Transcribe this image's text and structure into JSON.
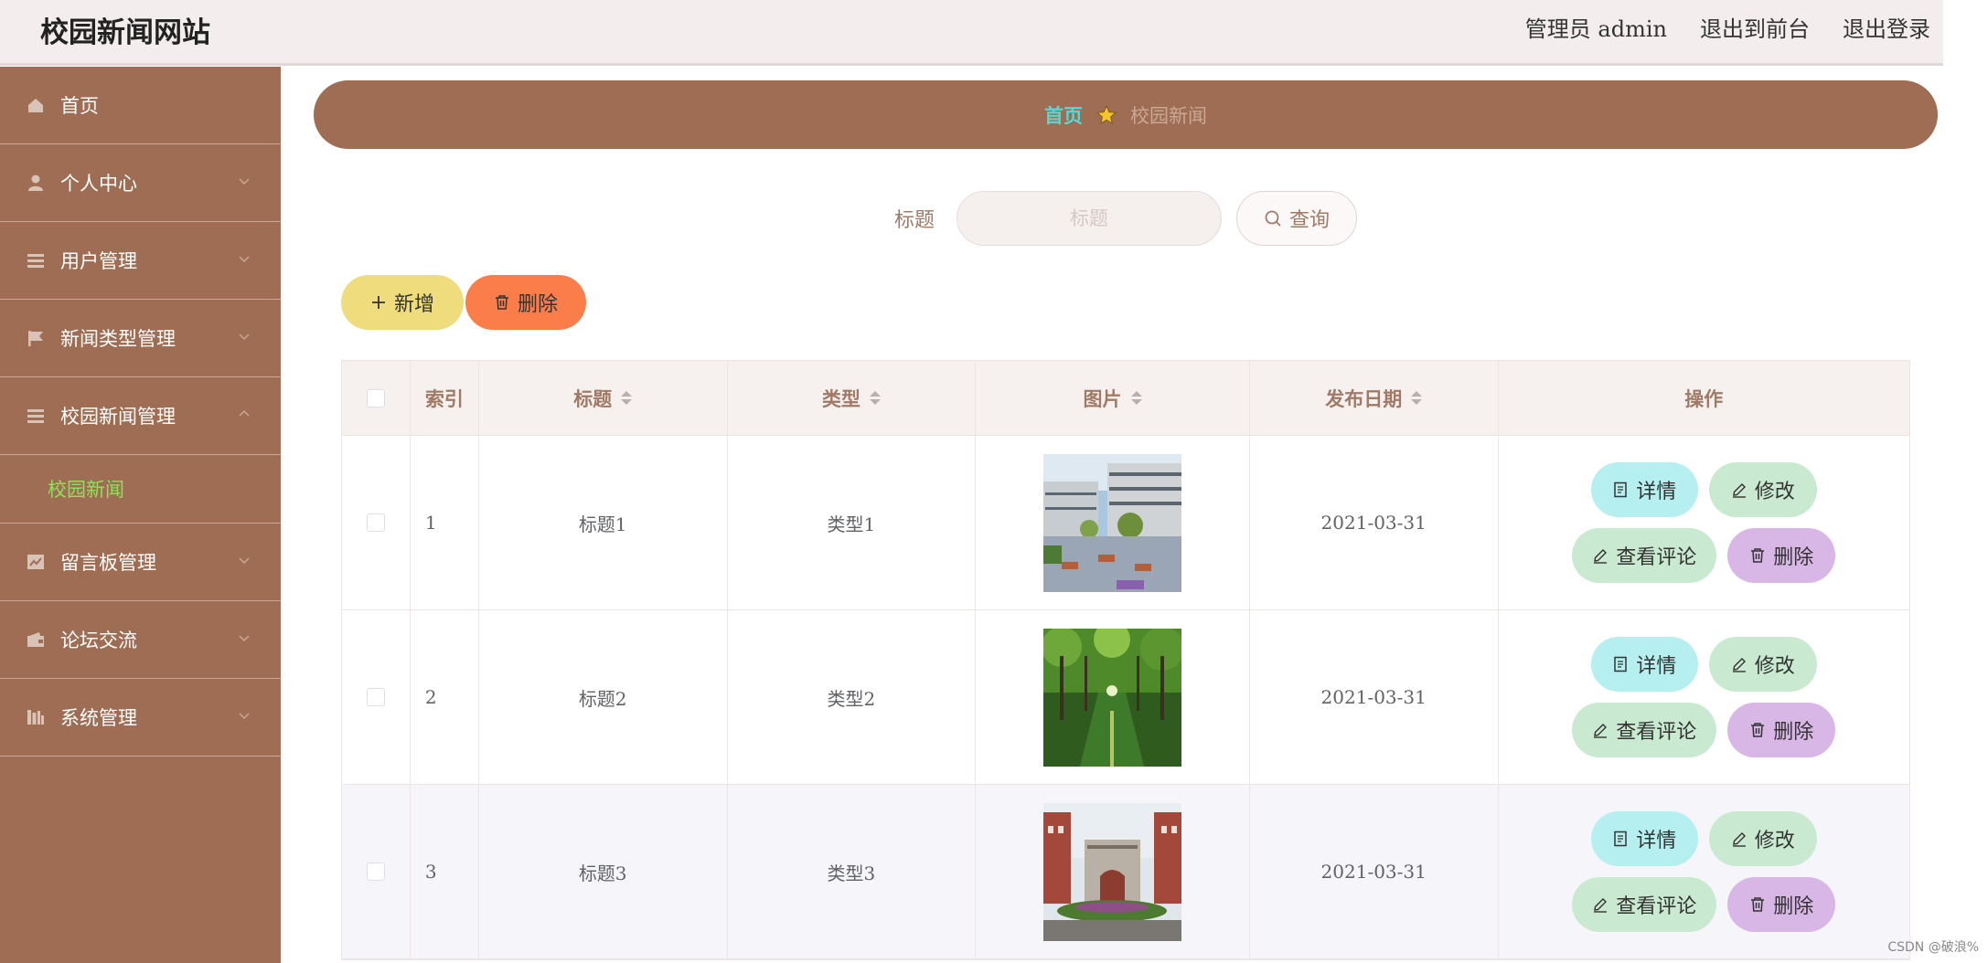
{
  "header": {
    "title": "校园新闻网站",
    "admin_label": "管理员 admin",
    "back_front": "退出到前台",
    "logout": "退出登录"
  },
  "sidebar": {
    "items": [
      {
        "label": "首页",
        "icon": "home-icon"
      },
      {
        "label": "个人中心",
        "icon": "user-icon"
      },
      {
        "label": "用户管理",
        "icon": "list-icon"
      },
      {
        "label": "新闻类型管理",
        "icon": "flag-icon"
      },
      {
        "label": "校园新闻管理",
        "icon": "list-icon",
        "expanded": true
      },
      {
        "label": "留言板管理",
        "icon": "chart-icon"
      },
      {
        "label": "论坛交流",
        "icon": "wallet-icon"
      },
      {
        "label": "系统管理",
        "icon": "bars-icon"
      }
    ],
    "submenu_active": "校园新闻",
    "active_color": "#8ee25a"
  },
  "breadcrumb": {
    "home": "首页",
    "current": "校园新闻"
  },
  "search": {
    "label": "标题",
    "placeholder": "标题",
    "button": "查询"
  },
  "actions": {
    "add": "新增",
    "delete": "删除"
  },
  "table": {
    "headers": {
      "index": "索引",
      "title": "标题",
      "type": "类型",
      "image": "图片",
      "date": "发布日期",
      "ops": "操作"
    },
    "rows": [
      {
        "index": "1",
        "title": "标题1",
        "type": "类型1",
        "date": "2021-03-31",
        "image": "campus-building-image"
      },
      {
        "index": "2",
        "title": "标题2",
        "type": "类型2",
        "date": "2021-03-31",
        "image": "tree-path-image"
      },
      {
        "index": "3",
        "title": "标题3",
        "type": "类型3",
        "date": "2021-03-31",
        "image": "campus-gate-image"
      }
    ],
    "ops": {
      "detail": "详情",
      "edit": "修改",
      "comments": "查看评论",
      "delete": "删除"
    }
  },
  "watermark": "CSDN @破浪%",
  "colors": {
    "brand": "#9e6d53",
    "header_bg": "#f3eeed",
    "breadcrumb_home": "#5ad6d8",
    "add_button": "#efdc7c",
    "delete_button": "#fb7e4a",
    "detail_button": "#b5eff0",
    "edit_button": "#c9ead1",
    "row_delete_button": "#d8b6e6"
  }
}
